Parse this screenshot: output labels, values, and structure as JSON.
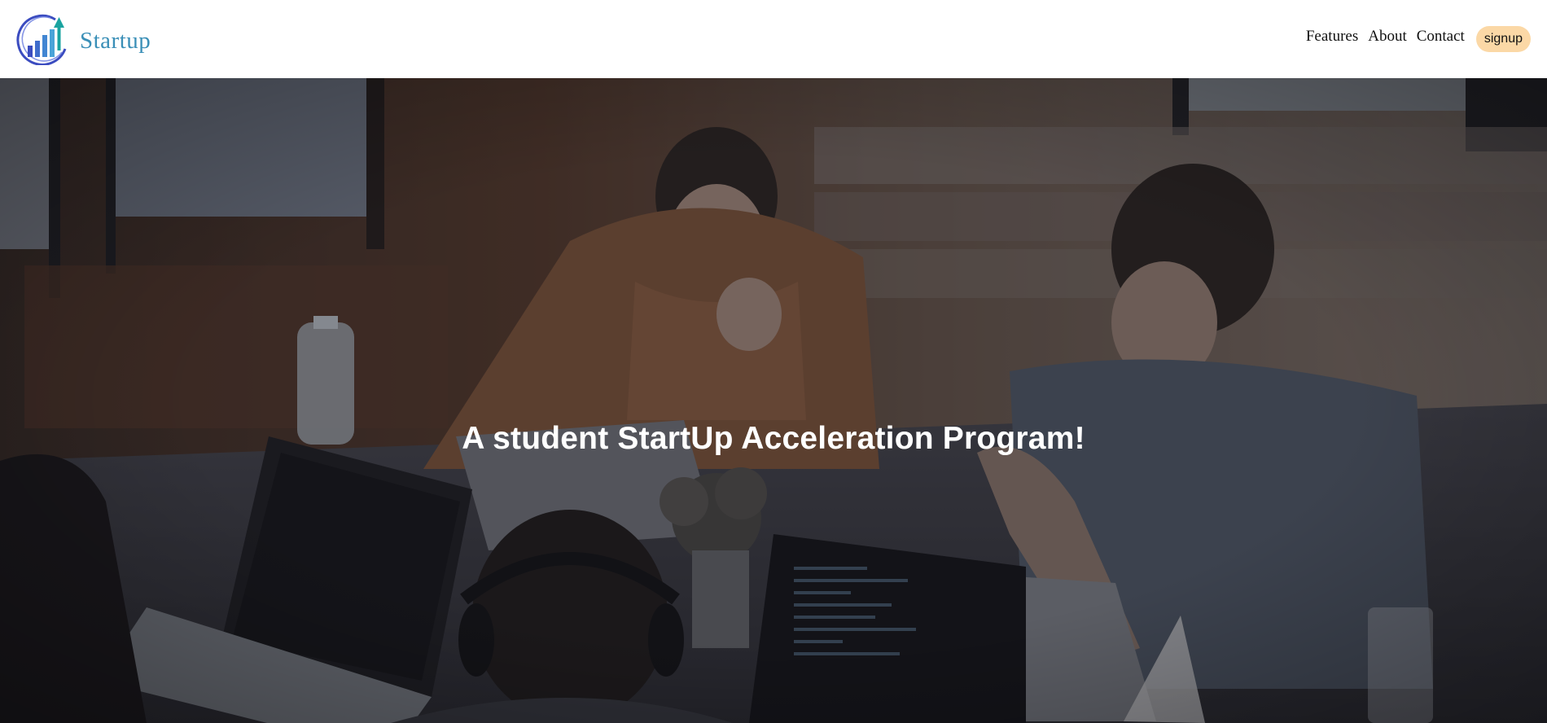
{
  "brand": {
    "name": "Startup",
    "logo_icon": "growth-chart-logo-icon",
    "colors": {
      "text": "#3a8fb7",
      "bars_dark": "#3b4cc0",
      "bars_light": "#4aa3d8",
      "arrow": "#1aa3a0"
    }
  },
  "nav": {
    "links": [
      {
        "label": "Features"
      },
      {
        "label": "About"
      },
      {
        "label": "Contact"
      }
    ],
    "signup_label": "signup",
    "signup_color": "#fbd8a6"
  },
  "hero": {
    "headline": "A student StartUp Acceleration Program!",
    "background_description_color": "#2b2c33"
  }
}
